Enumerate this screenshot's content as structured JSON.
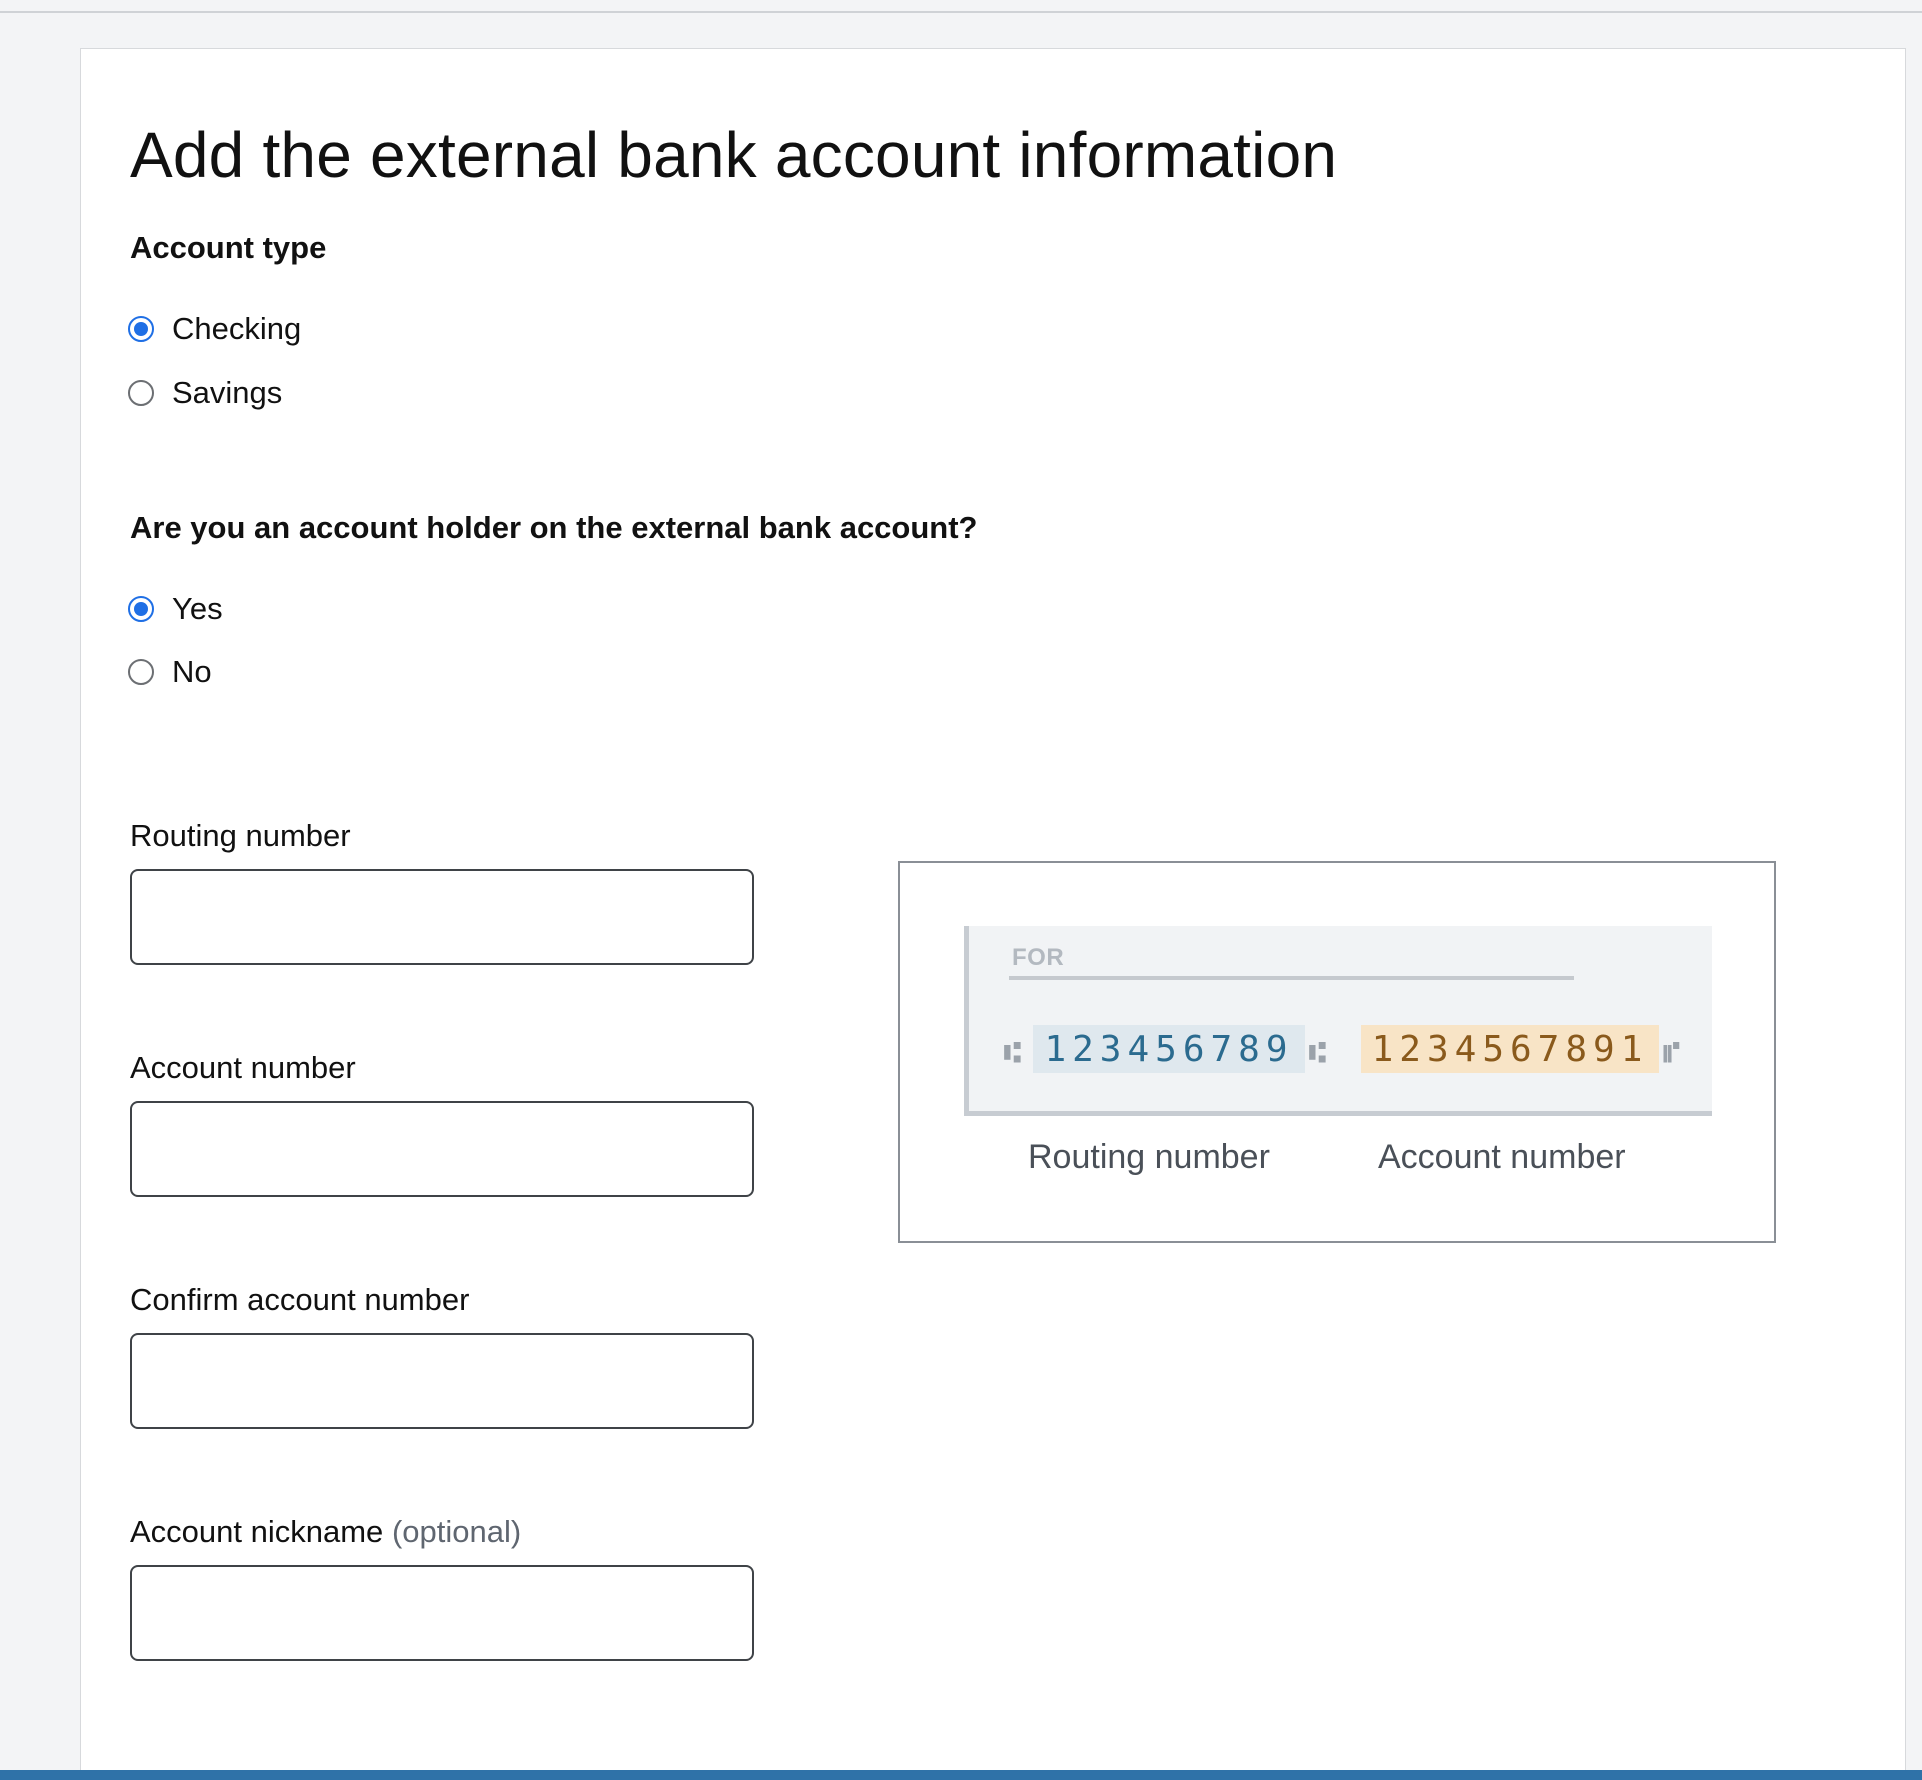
{
  "page": {
    "title": "Add the external bank account information"
  },
  "account_type": {
    "label": "Account type",
    "options": [
      {
        "label": "Checking",
        "checked": true
      },
      {
        "label": "Savings",
        "checked": false
      }
    ]
  },
  "account_holder": {
    "label": "Are you an account holder on the external bank account?",
    "options": [
      {
        "label": "Yes",
        "checked": true
      },
      {
        "label": "No",
        "checked": false
      }
    ]
  },
  "fields": {
    "routing_number": {
      "label": "Routing number",
      "value": ""
    },
    "account_number": {
      "label": "Account number",
      "value": ""
    },
    "confirm_account_number": {
      "label": "Confirm account number",
      "value": ""
    },
    "account_nickname": {
      "label": "Account nickname",
      "optional": "(optional)",
      "value": ""
    }
  },
  "check_illustration": {
    "for_text": "FOR",
    "routing_digits": "123456789",
    "account_digits": "1234567891",
    "routing_caption": "Routing number",
    "account_caption": "Account number"
  },
  "colors": {
    "radio_selected": "#1f6fe5",
    "routing_highlight": "#dfe8ee",
    "account_highlight": "#f8e4c6",
    "bottom_bar": "#2f72a8"
  }
}
